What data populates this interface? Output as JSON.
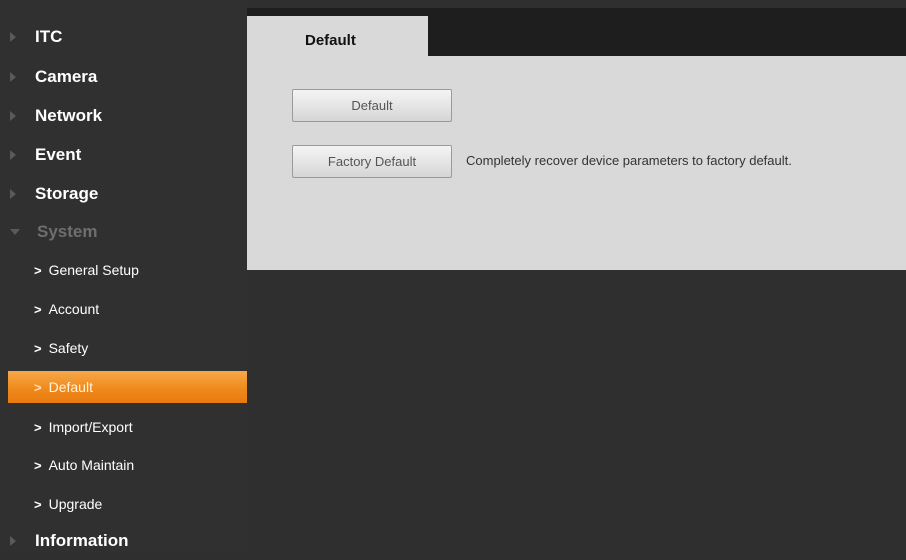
{
  "sidebar": {
    "items": [
      {
        "label": "ITC"
      },
      {
        "label": "Camera"
      },
      {
        "label": "Network"
      },
      {
        "label": "Event"
      },
      {
        "label": "Storage"
      },
      {
        "label": "System"
      },
      {
        "label": "Information"
      }
    ],
    "system_sub": [
      {
        "label": "General Setup"
      },
      {
        "label": "Account"
      },
      {
        "label": "Safety"
      },
      {
        "label": "Default"
      },
      {
        "label": "Import/Export"
      },
      {
        "label": "Auto Maintain"
      },
      {
        "label": "Upgrade"
      }
    ],
    "chevron": ">"
  },
  "content": {
    "tab_label": "Default",
    "default_button": "Default",
    "factory_button": "Factory Default",
    "factory_desc": "Completely recover device parameters to factory default."
  },
  "colors": {
    "active_item": "#f08a1c",
    "panel": "#d9d9d9",
    "background": "#2f2f2f"
  }
}
